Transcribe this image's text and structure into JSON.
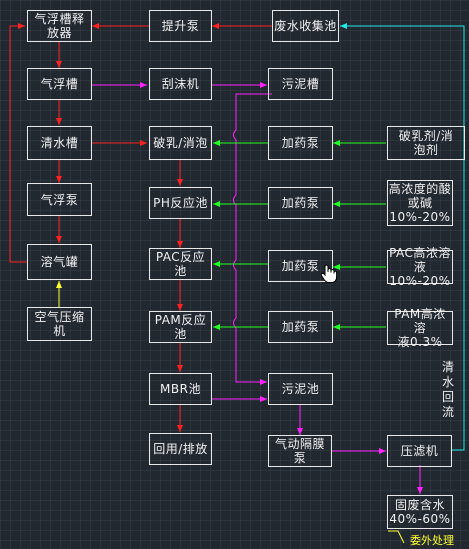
{
  "nodes": {
    "float_release": "气浮槽释\n放器",
    "lift_pump": "提升泵",
    "wastewater_tank": "废水收集池",
    "float_tank": "气浮槽",
    "scraper": "刮沫机",
    "sludge_tank": "污泥槽",
    "clear_tank": "清水槽",
    "demulsify": "破乳/消泡",
    "dosing_pump_1": "加药泵",
    "demulsifier_agent": "破乳剂/消\n泡剂",
    "float_pump": "气浮泵",
    "ph_tank": "PH反应池",
    "dosing_pump_2": "加药泵",
    "acid_base": "高浓度的酸\n或碱\n10%-20%",
    "dissolve_tank": "溶气罐",
    "pac_tank": "PAC反应池",
    "dosing_pump_3": "加药泵",
    "pac_solution": "PAC高浓溶\n液10%-20%",
    "air_compressor": "空气压缩\n机",
    "pam_tank": "PAM反应池",
    "dosing_pump_4": "加药泵",
    "pam_solution": "PAM高浓溶\n液0.3%",
    "mbr_tank": "MBR池",
    "sludge_pool": "污泥池",
    "reuse": "回用/排放",
    "diaphragm_pump": "气动隔膜\n泵",
    "filter_press": "压滤机",
    "solid_waste": "固废含水\n40%-60%"
  },
  "labels": {
    "clear_water_return": "清\n水\n回\n流",
    "outsourced": "委外处理"
  },
  "colors": {
    "red": "#ff2222",
    "magenta": "#ff22ff",
    "green": "#22ff22",
    "cyan": "#22e8e8",
    "yellow": "#ffff33"
  }
}
